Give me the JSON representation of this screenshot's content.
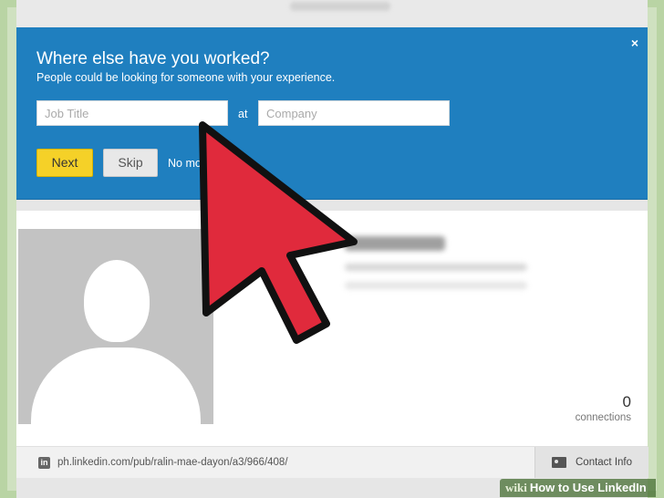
{
  "modal": {
    "title": "Where else have you worked?",
    "subtitle": "People could be looking for someone with your experience.",
    "job_title_placeholder": "Job Title",
    "at_label": "at",
    "company_placeholder": "Company",
    "next_label": "Next",
    "skip_label": "Skip",
    "no_more_label": "No mo",
    "close_label": "×"
  },
  "profile": {
    "connections_count": "0",
    "connections_label": "connections",
    "public_url": "ph.linkedin.com/pub/ralin-mae-dayon/a3/966/408/",
    "contact_info_label": "Contact Info",
    "linkedin_icon_letters": "in"
  },
  "banner": {
    "wiki": "wiki",
    "title": "How to Use LinkedIn"
  },
  "colors": {
    "modal_blue": "#1f7fbf",
    "next_yellow": "#f5d128",
    "cursor_red": "#e02a3c"
  },
  "icons": [
    "close-icon",
    "linkedin-icon",
    "contact-card-icon",
    "avatar-placeholder-icon",
    "pointer-cursor-icon"
  ]
}
